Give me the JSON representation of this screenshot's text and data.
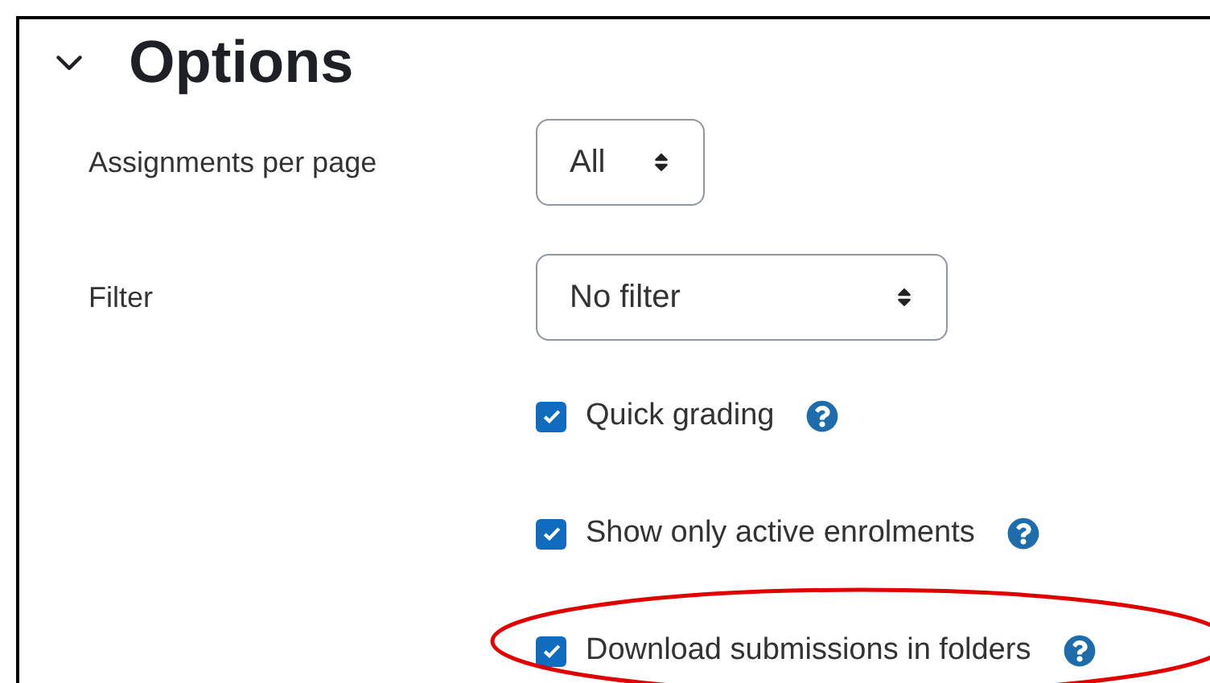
{
  "section": {
    "title": "Options",
    "expanded": true
  },
  "fields": [
    {
      "label": "Assignments per page",
      "value": "All"
    },
    {
      "label": "Filter",
      "value": "No filter"
    }
  ],
  "options": [
    {
      "label": "Quick grading",
      "checked": true,
      "highlighted": false
    },
    {
      "label": "Show only active enrolments",
      "checked": true,
      "highlighted": false
    },
    {
      "label": "Download submissions in folders",
      "checked": true,
      "highlighted": true
    }
  ]
}
